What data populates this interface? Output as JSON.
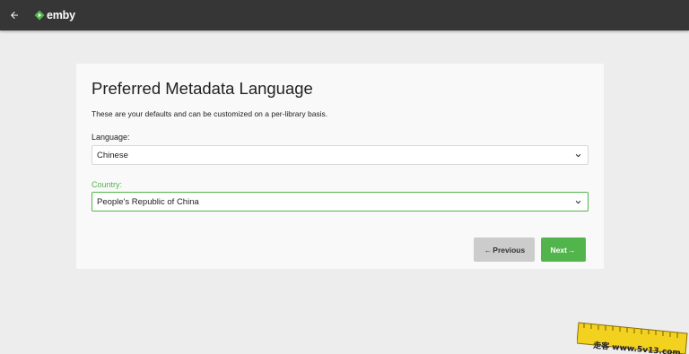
{
  "header": {
    "logo_text": "emby",
    "accent_color": "#52b54b",
    "bar_color": "#363636"
  },
  "wizard": {
    "title": "Preferred Metadata Language",
    "description": "These are your defaults and can be customized on a per-library basis.",
    "language": {
      "label": "Language:",
      "value": "Chinese"
    },
    "country": {
      "label": "Country:",
      "value": "People's Republic of China"
    },
    "previous_label": "Previous",
    "next_label": "Next"
  },
  "watermark": {
    "text": "走客 www.5v13.com"
  }
}
